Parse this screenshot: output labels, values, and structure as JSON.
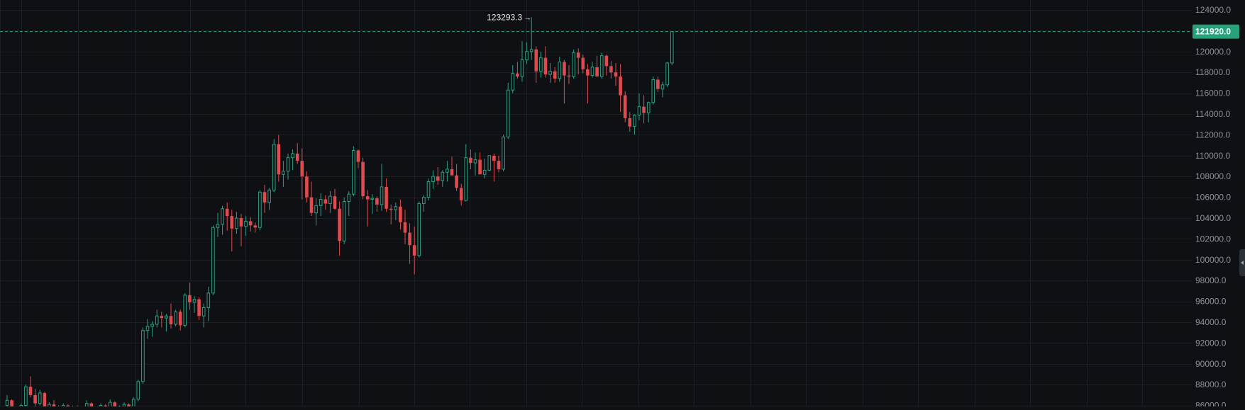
{
  "chart_data": {
    "type": "candlestick",
    "y_range": [
      85500,
      124800
    ],
    "y_ticks": [
      {
        "value": 124000,
        "label": "124000.0"
      },
      {
        "value": 122000,
        "label": "122000.0"
      },
      {
        "value": 120000,
        "label": "120000.0"
      },
      {
        "value": 118000,
        "label": "118000.0"
      },
      {
        "value": 116000,
        "label": "116000.0"
      },
      {
        "value": 114000,
        "label": "114000.0"
      },
      {
        "value": 112000,
        "label": "112000.0"
      },
      {
        "value": 110000,
        "label": "110000.0"
      },
      {
        "value": 108000,
        "label": "108000.0"
      },
      {
        "value": 106000,
        "label": "106000.0"
      },
      {
        "value": 104000,
        "label": "104000.0"
      },
      {
        "value": 102000,
        "label": "102000.0"
      },
      {
        "value": 100000,
        "label": "100000.0"
      },
      {
        "value": 98000,
        "label": "98000.0"
      },
      {
        "value": 96000,
        "label": "96000.0"
      },
      {
        "value": 94000,
        "label": "94000.0"
      },
      {
        "value": 92000,
        "label": "92000.0"
      },
      {
        "value": 90000,
        "label": "90000.0"
      },
      {
        "value": 88000,
        "label": "88000.0"
      },
      {
        "value": 86000,
        "label": "86000.0"
      }
    ],
    "current_price": {
      "value": 121920,
      "label": "121920.0"
    },
    "high_marker": {
      "value": 123293.3,
      "label": "123293.3"
    },
    "colors": {
      "background": "#0f1013",
      "grid": "#1c1f24",
      "up": "#2e9f83",
      "down": "#e04b4f",
      "axis_text": "#8b9097",
      "price_tag": "#26a17b",
      "price_line": "#26a17b",
      "marker_text": "#e8e8e8"
    },
    "candles": [
      [
        86000,
        87000,
        85500,
        86500
      ],
      [
        86500,
        86600,
        85000,
        85200
      ],
      [
        85200,
        85800,
        84500,
        85700
      ],
      [
        85700,
        86200,
        85200,
        86000
      ],
      [
        86000,
        88000,
        85900,
        87800
      ],
      [
        87800,
        88800,
        86800,
        87000
      ],
      [
        87000,
        87600,
        85800,
        86200
      ],
      [
        86200,
        87500,
        86000,
        87200
      ],
      [
        87200,
        87300,
        85500,
        85700
      ],
      [
        85700,
        86300,
        84800,
        86100
      ],
      [
        86100,
        86500,
        85200,
        85600
      ],
      [
        85600,
        86000,
        84800,
        85800
      ],
      [
        85800,
        86200,
        85200,
        86000
      ],
      [
        86000,
        86100,
        84900,
        85100
      ],
      [
        85100,
        86000,
        84200,
        85800
      ],
      [
        85800,
        86000,
        84800,
        85100
      ],
      [
        85100,
        85800,
        84600,
        85500
      ],
      [
        85500,
        86500,
        85000,
        86200
      ],
      [
        86200,
        86300,
        85000,
        85300
      ],
      [
        85300,
        85800,
        84300,
        85600
      ],
      [
        85600,
        86200,
        85200,
        86000
      ],
      [
        86000,
        86100,
        85200,
        85500
      ],
      [
        85500,
        86600,
        85300,
        86300
      ],
      [
        86300,
        86400,
        85300,
        85500
      ],
      [
        85500,
        86000,
        84800,
        85900
      ],
      [
        85900,
        86300,
        85200,
        86100
      ],
      [
        86100,
        86200,
        85000,
        85300
      ],
      [
        85300,
        86800,
        85100,
        86600
      ],
      [
        86600,
        88500,
        86400,
        88300
      ],
      [
        88300,
        93500,
        88100,
        93200
      ],
      [
        93200,
        94300,
        92400,
        93600
      ],
      [
        93600,
        94100,
        92600,
        93800
      ],
      [
        93800,
        95200,
        93500,
        94600
      ],
      [
        94600,
        95000,
        93500,
        94400
      ],
      [
        94400,
        94800,
        93100,
        94600
      ],
      [
        94600,
        95800,
        93400,
        93800
      ],
      [
        93800,
        95200,
        93600,
        95000
      ],
      [
        95000,
        95200,
        93200,
        93700
      ],
      [
        93700,
        96800,
        93500,
        96600
      ],
      [
        96600,
        97800,
        95200,
        95900
      ],
      [
        95900,
        96500,
        94900,
        96200
      ],
      [
        96200,
        96400,
        94200,
        94600
      ],
      [
        94600,
        95800,
        93500,
        95400
      ],
      [
        95400,
        97400,
        94100,
        96800
      ],
      [
        96800,
        103300,
        96600,
        103100
      ],
      [
        103100,
        104500,
        102200,
        103400
      ],
      [
        103400,
        105200,
        102400,
        104900
      ],
      [
        104900,
        105500,
        102800,
        104200
      ],
      [
        104200,
        104800,
        100800,
        103000
      ],
      [
        103000,
        104600,
        102500,
        104000
      ],
      [
        104000,
        104400,
        101300,
        103200
      ],
      [
        103200,
        104200,
        102300,
        103700
      ],
      [
        103700,
        104100,
        102700,
        103300
      ],
      [
        103300,
        103600,
        102600,
        103100
      ],
      [
        103100,
        106700,
        102800,
        106500
      ],
      [
        106500,
        107200,
        104500,
        105500
      ],
      [
        105500,
        106900,
        104800,
        106700
      ],
      [
        106700,
        111600,
        106500,
        111100
      ],
      [
        111100,
        112000,
        107500,
        108200
      ],
      [
        108200,
        109500,
        107000,
        108500
      ],
      [
        108500,
        110200,
        107700,
        109800
      ],
      [
        109800,
        110600,
        108600,
        110200
      ],
      [
        110200,
        111200,
        109200,
        109500
      ],
      [
        109500,
        110700,
        105800,
        108000
      ],
      [
        108000,
        108500,
        105500,
        106000
      ],
      [
        106000,
        107500,
        104200,
        104500
      ],
      [
        104500,
        105900,
        103300,
        105200
      ],
      [
        105200,
        106400,
        104200,
        105800
      ],
      [
        105800,
        106200,
        104800,
        105400
      ],
      [
        105400,
        106600,
        104500,
        106100
      ],
      [
        106100,
        106800,
        104800,
        104900
      ],
      [
        104900,
        105600,
        100400,
        101800
      ],
      [
        101800,
        106000,
        101500,
        105600
      ],
      [
        105600,
        106600,
        104200,
        106300
      ],
      [
        106300,
        110900,
        106100,
        110500
      ],
      [
        110500,
        110600,
        108800,
        109400
      ],
      [
        109400,
        109800,
        105800,
        106100
      ],
      [
        106100,
        106700,
        103200,
        105800
      ],
      [
        105800,
        106300,
        104400,
        105900
      ],
      [
        105900,
        106100,
        104600,
        105300
      ],
      [
        105300,
        109200,
        104700,
        107000
      ],
      [
        107000,
        107800,
        104600,
        104900
      ],
      [
        104900,
        105300,
        103400,
        104800
      ],
      [
        104800,
        105500,
        103800,
        105100
      ],
      [
        105100,
        105800,
        102900,
        103600
      ],
      [
        103600,
        104800,
        101500,
        102600
      ],
      [
        102600,
        103500,
        99600,
        101400
      ],
      [
        101400,
        103200,
        98600,
        100400
      ],
      [
        100400,
        105600,
        100200,
        105400
      ],
      [
        105400,
        106200,
        104600,
        106000
      ],
      [
        106000,
        107800,
        105700,
        107500
      ],
      [
        107500,
        108600,
        106800,
        108000
      ],
      [
        108000,
        108900,
        107200,
        107600
      ],
      [
        107600,
        108600,
        107000,
        108400
      ],
      [
        108400,
        109500,
        107500,
        108700
      ],
      [
        108700,
        109900,
        108200,
        108100
      ],
      [
        108100,
        109200,
        106600,
        106900
      ],
      [
        106900,
        107300,
        105200,
        105700
      ],
      [
        105700,
        111100,
        105600,
        109800
      ],
      [
        109800,
        110600,
        108700,
        109300
      ],
      [
        109300,
        110300,
        108100,
        109600
      ],
      [
        109600,
        110300,
        108300,
        108200
      ],
      [
        108200,
        109700,
        107800,
        108600
      ],
      [
        108600,
        110000,
        108500,
        110000
      ],
      [
        110000,
        110200,
        107500,
        109500
      ],
      [
        109500,
        110000,
        108400,
        108700
      ],
      [
        108700,
        112000,
        108500,
        111800
      ],
      [
        111800,
        117000,
        111600,
        116300
      ],
      [
        116300,
        118700,
        116000,
        117900
      ],
      [
        117900,
        119000,
        117400,
        117600
      ],
      [
        117600,
        121000,
        117100,
        119200
      ],
      [
        119200,
        120900,
        118800,
        120000
      ],
      [
        120000,
        123293,
        119200,
        120200
      ],
      [
        120200,
        120500,
        117000,
        118100
      ],
      [
        118100,
        120000,
        117500,
        119400
      ],
      [
        119400,
        120500,
        117500,
        117800
      ],
      [
        117800,
        118900,
        117000,
        118100
      ],
      [
        118100,
        118500,
        117000,
        117400
      ],
      [
        117400,
        119500,
        117100,
        119000
      ],
      [
        119000,
        119200,
        115000,
        117700
      ],
      [
        117700,
        118700,
        116900,
        117600
      ],
      [
        117600,
        120200,
        117400,
        119900
      ],
      [
        119900,
        120300,
        117800,
        119400
      ],
      [
        119400,
        119700,
        117900,
        118300
      ],
      [
        118300,
        118800,
        115000,
        117700
      ],
      [
        117700,
        119000,
        117500,
        118500
      ],
      [
        118500,
        119600,
        117800,
        117600
      ],
      [
        117600,
        119900,
        117400,
        119600
      ],
      [
        119600,
        119700,
        117700,
        118600
      ],
      [
        118600,
        119100,
        117400,
        118000
      ],
      [
        118000,
        118900,
        116700,
        117600
      ],
      [
        117600,
        118800,
        114200,
        115800
      ],
      [
        115800,
        116200,
        113200,
        113600
      ],
      [
        113600,
        114200,
        112300,
        112800
      ],
      [
        112800,
        114000,
        112000,
        113900
      ],
      [
        113900,
        116000,
        113400,
        114700
      ],
      [
        114700,
        115800,
        113100,
        114100
      ],
      [
        114100,
        115200,
        113200,
        115100
      ],
      [
        115100,
        117600,
        114900,
        117300
      ],
      [
        117300,
        117600,
        116100,
        116400
      ],
      [
        116400,
        117100,
        115600,
        116800
      ],
      [
        116800,
        119000,
        116600,
        118900
      ],
      [
        118900,
        121920,
        118700,
        121920
      ]
    ]
  }
}
